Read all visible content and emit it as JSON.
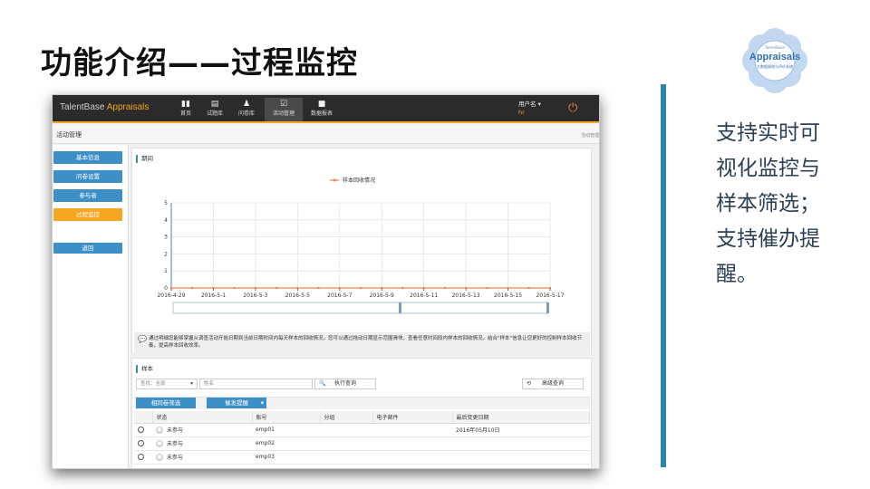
{
  "slide": {
    "title": "功能介绍——过程监控",
    "side_text": [
      "支持实时可",
      "视化监控与",
      "样本筛选；",
      "支持催办提",
      "醒。"
    ],
    "accent_color": "#2a86b0"
  },
  "logo": {
    "top_text": "TalentBase",
    "text": "Appraisals",
    "sub_text": "大数据绩效与评价系统"
  },
  "app": {
    "brand_main": "TalentBase",
    "brand_accent": "Appraisals",
    "nav": [
      {
        "label": "首页",
        "icon": "bar-chart-icon"
      },
      {
        "label": "试题库",
        "icon": "card-icon"
      },
      {
        "label": "问卷库",
        "icon": "users-icon"
      },
      {
        "label": "活动管理",
        "icon": "check-square-icon",
        "active": true
      },
      {
        "label": "数据报表",
        "icon": "cube-icon"
      }
    ],
    "user": {
      "name": "用户名 ▾",
      "id": "hr"
    },
    "power_icon": "⏻",
    "page_title": "活动管理",
    "breadcrumb_right": "活动管理",
    "left_menu": [
      {
        "label": "基本信息"
      },
      {
        "label": "问卷设置"
      },
      {
        "label": "参与者"
      },
      {
        "label": "过程监控",
        "active": true
      },
      {
        "label": "返回"
      }
    ],
    "period": {
      "heading": "期间",
      "hint": "通过明细您能够掌握从调查活动开始日期到当前日期时间内每天样本的回收情况，您可以通过拖动日期显示范围滑块，查看任意时间段内样本的回收情况。结合\"样本\"信息让您更好的控制样本回收节奏，提高样本回收效率。"
    },
    "samples": {
      "heading": "样本",
      "filter_select": "查找：全部",
      "name_placeholder": "姓名",
      "search_button": "执行查询",
      "advanced_button": "高级查询",
      "related_filter_button": "相同卷筛选",
      "remind_button": "催发提醒",
      "columns": [
        "状态",
        "账号",
        "分组",
        "电子邮件",
        "最后变更日期"
      ],
      "rows": [
        {
          "status": "未参与",
          "account": "emp01",
          "group": "",
          "email": "",
          "last_changed": "2016年05月10日"
        },
        {
          "status": "未参与",
          "account": "emp02",
          "group": "",
          "email": "",
          "last_changed": ""
        },
        {
          "status": "未参与",
          "account": "emp03",
          "group": "",
          "email": "",
          "last_changed": ""
        }
      ]
    }
  },
  "chart_data": {
    "type": "line",
    "title": "",
    "series": [
      {
        "name": "样本回收情况",
        "color": "#f08050",
        "values": [
          0,
          0,
          0,
          0,
          0,
          0,
          0,
          0,
          0,
          0,
          0,
          0,
          0,
          0,
          0,
          0,
          0,
          0,
          0
        ]
      }
    ],
    "x": [
      "2016-4-29",
      "2016-4-30",
      "2016-5-1",
      "2016-5-2",
      "2016-5-3",
      "2016-5-4",
      "2016-5-5",
      "2016-5-6",
      "2016-5-7",
      "2016-5-8",
      "2016-5-9",
      "2016-5-10",
      "2016-5-11",
      "2016-5-12",
      "2016-5-13",
      "2016-5-14",
      "2016-5-15",
      "2016-5-16",
      "2016-5-17"
    ],
    "x_tick_labels": [
      "2016-4-29",
      "2016-5-1",
      "2016-5-3",
      "2016-5-5",
      "2016-5-7",
      "2016-5-9",
      "2016-5-11",
      "2016-5-13",
      "2016-5-15",
      "2016-5-17"
    ],
    "y_ticks": [
      0,
      1,
      2,
      3,
      4,
      5
    ],
    "ylim": [
      0,
      5
    ],
    "grid": true,
    "legend": "top-center"
  }
}
